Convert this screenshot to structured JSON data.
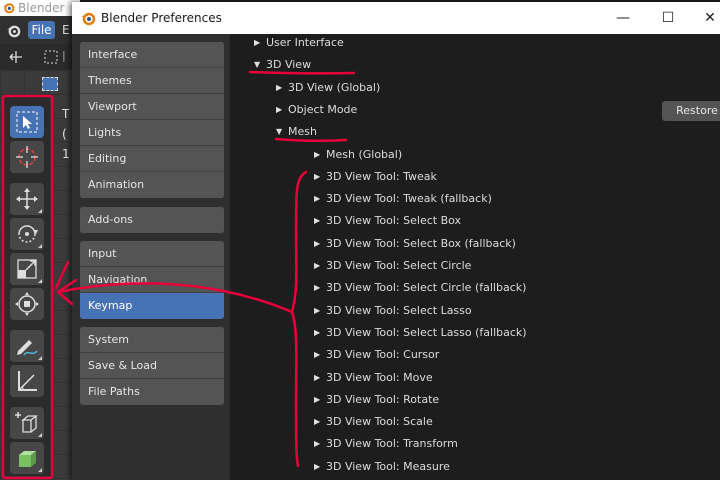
{
  "background_app": {
    "title": "Blender",
    "menu_file": "File",
    "menu_edit": "E",
    "overlay_lines": [
      "T",
      "(",
      "1"
    ]
  },
  "prefs": {
    "title": "Blender Preferences",
    "window_buttons": [
      "—",
      "☐",
      "✕"
    ],
    "sidebar_groups": [
      [
        "Interface",
        "Themes",
        "Viewport",
        "Lights",
        "Editing",
        "Animation"
      ],
      [
        "Add-ons"
      ],
      [
        "Input",
        "Navigation",
        "Keymap"
      ],
      [
        "System",
        "Save & Load",
        "File Paths"
      ]
    ],
    "active_item": "Keymap",
    "restore_label": "Restore",
    "tree": [
      {
        "label": "User Interface",
        "expanded": false,
        "level": 0
      },
      {
        "label": "3D View",
        "expanded": true,
        "level": 0
      },
      {
        "label": "3D View (Global)",
        "expanded": false,
        "level": 1
      },
      {
        "label": "Object Mode",
        "expanded": false,
        "level": 1
      },
      {
        "label": "Mesh",
        "expanded": true,
        "level": 1
      },
      {
        "label": "Mesh (Global)",
        "expanded": false,
        "level": 2
      },
      {
        "label": "3D View Tool: Tweak",
        "expanded": false,
        "level": 2
      },
      {
        "label": "3D View Tool: Tweak (fallback)",
        "expanded": false,
        "level": 2
      },
      {
        "label": "3D View Tool: Select Box",
        "expanded": false,
        "level": 2
      },
      {
        "label": "3D View Tool: Select Box (fallback)",
        "expanded": false,
        "level": 2
      },
      {
        "label": "3D View Tool: Select Circle",
        "expanded": false,
        "level": 2
      },
      {
        "label": "3D View Tool: Select Circle (fallback)",
        "expanded": false,
        "level": 2
      },
      {
        "label": "3D View Tool: Select Lasso",
        "expanded": false,
        "level": 2
      },
      {
        "label": "3D View Tool: Select Lasso (fallback)",
        "expanded": false,
        "level": 2
      },
      {
        "label": "3D View Tool: Cursor",
        "expanded": false,
        "level": 2
      },
      {
        "label": "3D View Tool: Move",
        "expanded": false,
        "level": 2
      },
      {
        "label": "3D View Tool: Rotate",
        "expanded": false,
        "level": 2
      },
      {
        "label": "3D View Tool: Scale",
        "expanded": false,
        "level": 2
      },
      {
        "label": "3D View Tool: Transform",
        "expanded": false,
        "level": 2
      },
      {
        "label": "3D View Tool: Measure",
        "expanded": false,
        "level": 2
      }
    ]
  },
  "toolbar_tools": [
    "select-box-icon",
    "cursor-icon",
    "move-icon",
    "rotate-icon",
    "scale-icon",
    "transform-icon",
    "annotate-icon",
    "measure-icon",
    "add-cube-icon",
    "extrude-icon"
  ],
  "colors": {
    "accent": "#4772b3",
    "annotation": "#e8003a",
    "panel": "#2f2f2f",
    "main_bg": "#1d1d1d"
  }
}
